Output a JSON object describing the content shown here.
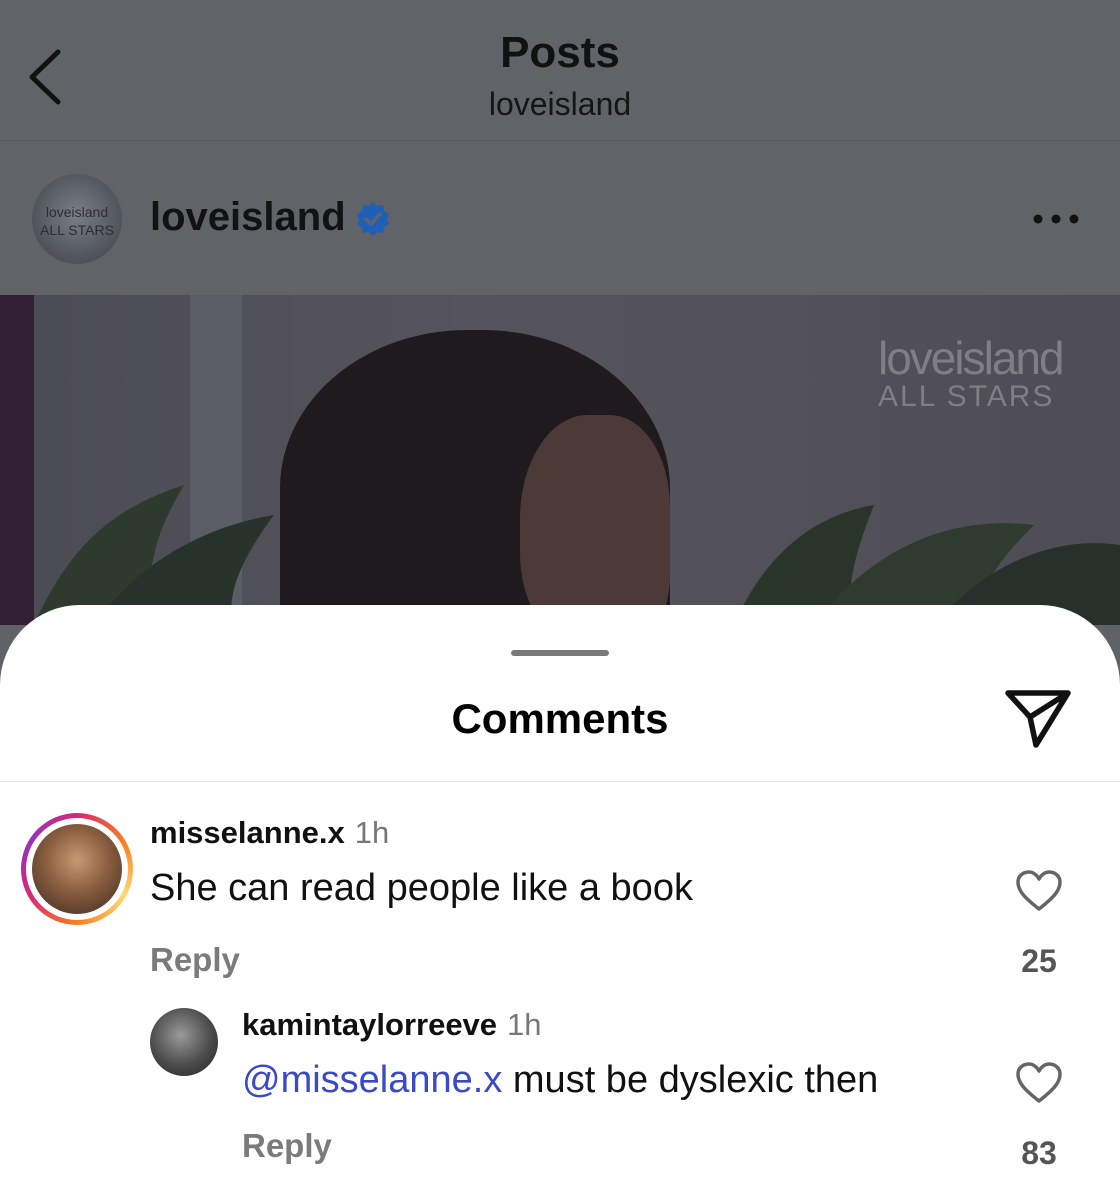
{
  "header": {
    "title": "Posts",
    "subtitle": "loveisland"
  },
  "account": {
    "name": "loveisland",
    "avatar_text_1": "loveisland",
    "avatar_text_2": "ALL STARS",
    "verified_color": "#1f6fd1"
  },
  "photo": {
    "brand_line_1": "loveisland",
    "brand_line_2": "ALL STARS"
  },
  "comments_sheet": {
    "title": "Comments",
    "comments": [
      {
        "username": "misselanne.x",
        "time": "1h",
        "text": "She can read people like a book",
        "reply_label": "Reply",
        "likes": "25"
      },
      {
        "username": "kamintaylorreeve",
        "time": "1h",
        "mention": "@misselanne.x",
        "text": " must be dyslexic then",
        "reply_label": "Reply",
        "likes": "83"
      }
    ]
  },
  "colors": {
    "mention": "#3a49c7",
    "overlay": "#606367"
  }
}
